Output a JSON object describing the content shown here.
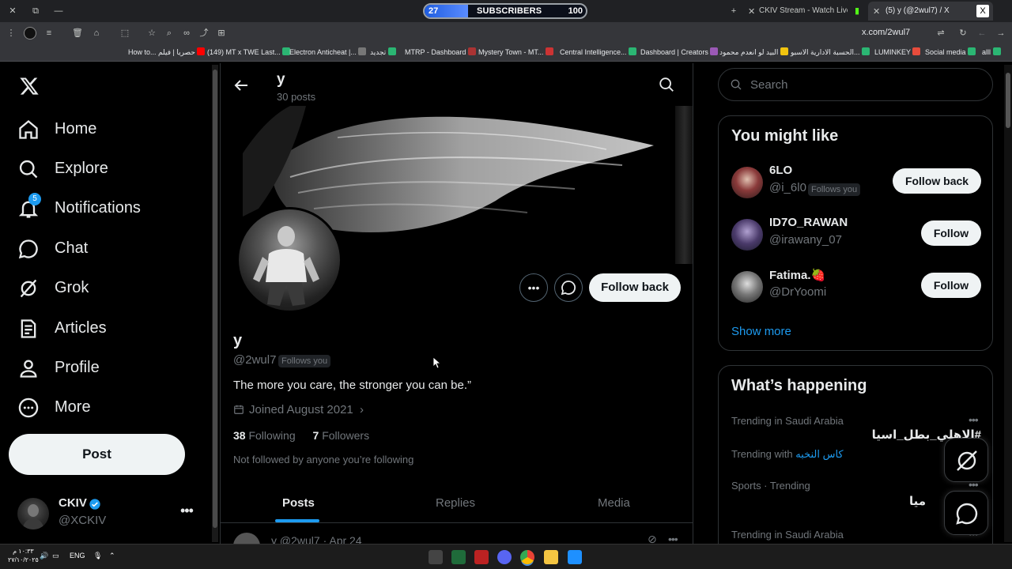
{
  "browser": {
    "subscriber_widget": {
      "left_count": "27",
      "label": "SUBSCRIBERS",
      "right_count": "100",
      "progress_percent": 27
    },
    "tabs": [
      {
        "label": "CKIV Stream - Watch Live on Ki"
      },
      {
        "label": "(5) y (@2wul7) / X"
      }
    ],
    "url": "x.com/2wul7",
    "bookmarks": [
      "How to... حصريا | فيلم",
      "(149) MT x TWE Last...",
      "Electron Anticheat |...",
      "تجديد",
      "MTRP - Dashboard",
      "Mystery Town - MT...",
      "Central Intelligence...",
      "Dashboard | Creators",
      "البيد لو انعدم محمود",
      "الحسبة الادارية الاسبو...",
      "LUMINKEY",
      "Social media",
      "alll"
    ]
  },
  "nav": {
    "items": [
      {
        "label": "Home",
        "icon": "home-icon"
      },
      {
        "label": "Explore",
        "icon": "search-icon"
      },
      {
        "label": "Notifications",
        "icon": "bell-icon",
        "badge": "5"
      },
      {
        "label": "Chat",
        "icon": "chat-icon"
      },
      {
        "label": "Grok",
        "icon": "grok-icon"
      },
      {
        "label": "Articles",
        "icon": "article-icon"
      },
      {
        "label": "Profile",
        "icon": "profile-icon"
      },
      {
        "label": "More",
        "icon": "more-circle-icon"
      }
    ],
    "post_label": "Post",
    "account": {
      "name": "CKIV",
      "handle": "@XCKIV"
    }
  },
  "profile": {
    "header_name": "y",
    "header_count": "30 posts",
    "display_name": "y",
    "handle": "@2wul7",
    "follows_you": "Follows you",
    "bio": "The more you care, the stronger you can be.”",
    "joined": "Joined August 2021",
    "following_count": "38",
    "following_label": "Following",
    "followers_count": "7",
    "followers_label": "Followers",
    "not_followed": "Not followed by anyone you’re following",
    "follow_back_label": "Follow back",
    "tabs": [
      "Posts",
      "Replies",
      "Media"
    ],
    "post_preview": "y @2wul7 · Apr 24"
  },
  "right": {
    "search_placeholder": "Search",
    "wtf_title": "You might like",
    "suggestions": [
      {
        "name": "6LO",
        "handle": "@i_6l0",
        "follows_you": "Follows you",
        "button": "Follow back"
      },
      {
        "name": "ID7O_RAWAN",
        "handle": "@irawany_07",
        "button": "Follow"
      },
      {
        "name": "Fatima.🍓",
        "handle": "@DrYoomi",
        "button": "Follow"
      }
    ],
    "show_more": "Show more",
    "trends_title": "What’s happening",
    "trends": [
      {
        "context": "Trending in Saudi Arabia",
        "name": "#الاهلي_بطل_اسيا"
      },
      {
        "context": "Trending with",
        "link": "كاس النخبه"
      },
      {
        "context": "Sports · Trending",
        "name": "ميا"
      },
      {
        "context": "Trending in Saudi Arabia"
      }
    ]
  },
  "taskbar": {
    "time": "١٠:٣٣ م",
    "date": "٢٧/١٠/٢٠٢٥",
    "lang": "ENG"
  }
}
